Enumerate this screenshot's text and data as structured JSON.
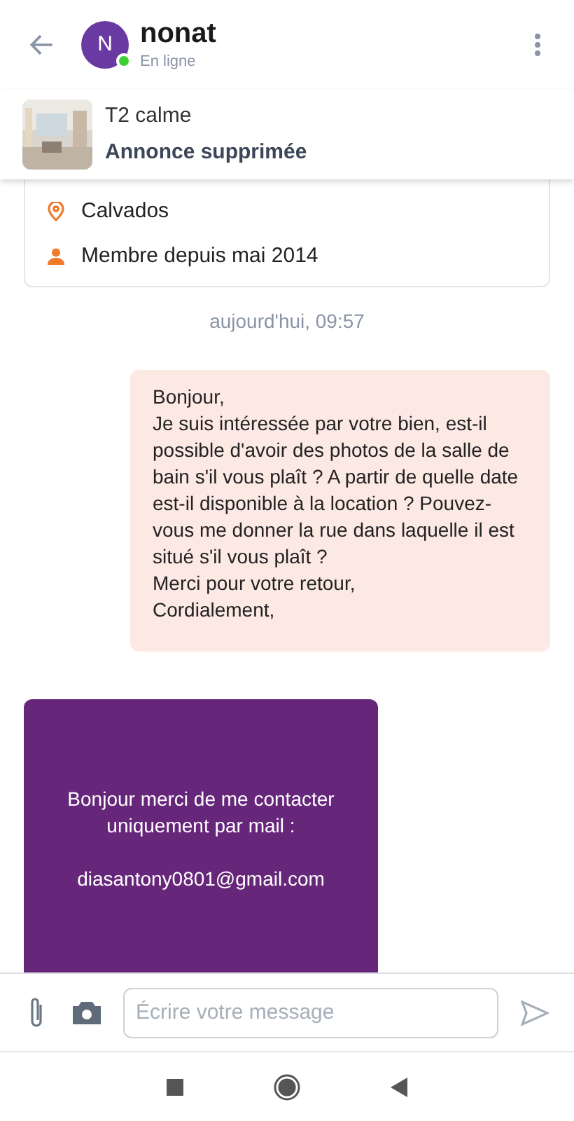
{
  "header": {
    "avatar_letter": "N",
    "name": "nonat",
    "status": "En ligne",
    "online": true
  },
  "listing": {
    "kind": "picture",
    "title": "T2 calme",
    "status": "Annonce supprimée"
  },
  "seller_card": {
    "location": "Calvados",
    "member_since": "Membre depuis mai 2014"
  },
  "date_separator": "aujourd'hui, 09:57",
  "messages": [
    {
      "kind": "sent",
      "text": "Bonjour,\nJe suis intéressée par votre bien, est-il possible d'avoir des photos de la salle de bain s'il vous plaît ? A partir de quelle date est-il disponible à la location ? Pouvez-vous me donner la rue dans laquelle il est situé s'il vous plaît ?\nMerci pour votre retour,\nCordialement,"
    },
    {
      "kind": "received",
      "text": "Bonjour merci de me contacter uniquement par mail :\n\ndiasantony0801@gmail.com"
    }
  ],
  "composer": {
    "placeholder": "Écrire votre message"
  }
}
